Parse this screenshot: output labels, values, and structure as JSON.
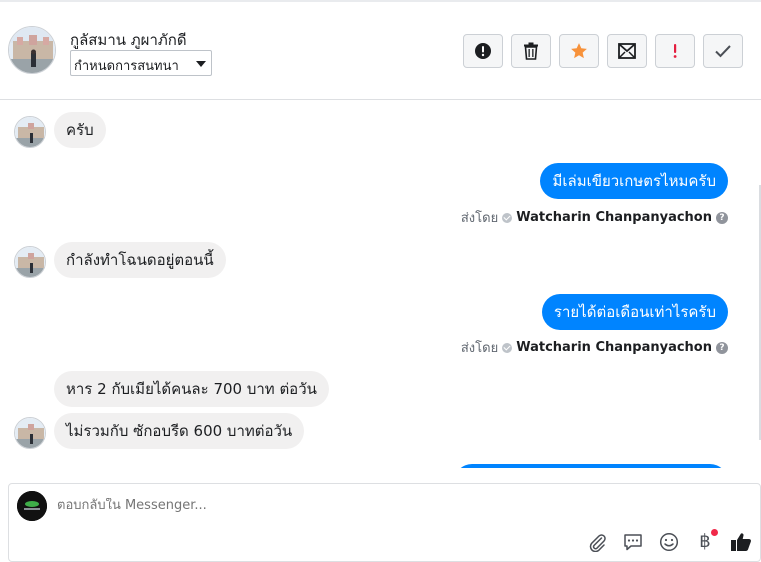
{
  "header": {
    "contact_name": "กูลัสมาน ภูผาภักดี",
    "label_select": {
      "value": "กำหนดการสนทนา"
    },
    "toolbar": [
      {
        "name": "info-button",
        "icon": "exclamation-circle-icon"
      },
      {
        "name": "delete-button",
        "icon": "trash-icon"
      },
      {
        "name": "star-button",
        "icon": "star-icon",
        "accent": "#f7923b"
      },
      {
        "name": "mark-unread-button",
        "icon": "envelope-icon"
      },
      {
        "name": "spam-button",
        "icon": "exclamation-icon",
        "accent": "#e41e3f"
      },
      {
        "name": "done-button",
        "icon": "check-icon"
      }
    ]
  },
  "messages": [
    {
      "dir": "in",
      "text": "ครับ",
      "avatar": true
    },
    {
      "dir": "out",
      "text": "มีเล่มเขียวเกษตรไหมครับ",
      "sent_by_label": "ส่งโดย",
      "sender": "Watcharin Chanpanyachon"
    },
    {
      "dir": "in",
      "text": "กำลังทำโฉนดอยู่ตอนนี้",
      "avatar": true
    },
    {
      "dir": "out",
      "text": "รายได้ต่อเดือนเท่าไรครับ",
      "sent_by_label": "ส่งโดย",
      "sender": "Watcharin Chanpanyachon"
    },
    {
      "dir": "in",
      "text": "หาร 2 กับเมียได้คนละ 700 บาท ต่อวัน",
      "avatar": false
    },
    {
      "dir": "in",
      "text": "ไม่รวมกับ ซักอบรีด 600 บาทต่อวัน",
      "avatar": true
    }
  ],
  "composer": {
    "placeholder": "ตอบกลับใน Messenger...",
    "currency_symbol": "฿",
    "icons": [
      "paperclip-icon",
      "saved-replies-icon",
      "emoji-icon",
      "baht-payment-icon",
      "like-icon"
    ]
  },
  "colors": {
    "outgoing_bubble": "#0084ff",
    "incoming_bubble": "#f1f0f0",
    "star_accent": "#f7923b",
    "spam_accent": "#e41e3f"
  }
}
